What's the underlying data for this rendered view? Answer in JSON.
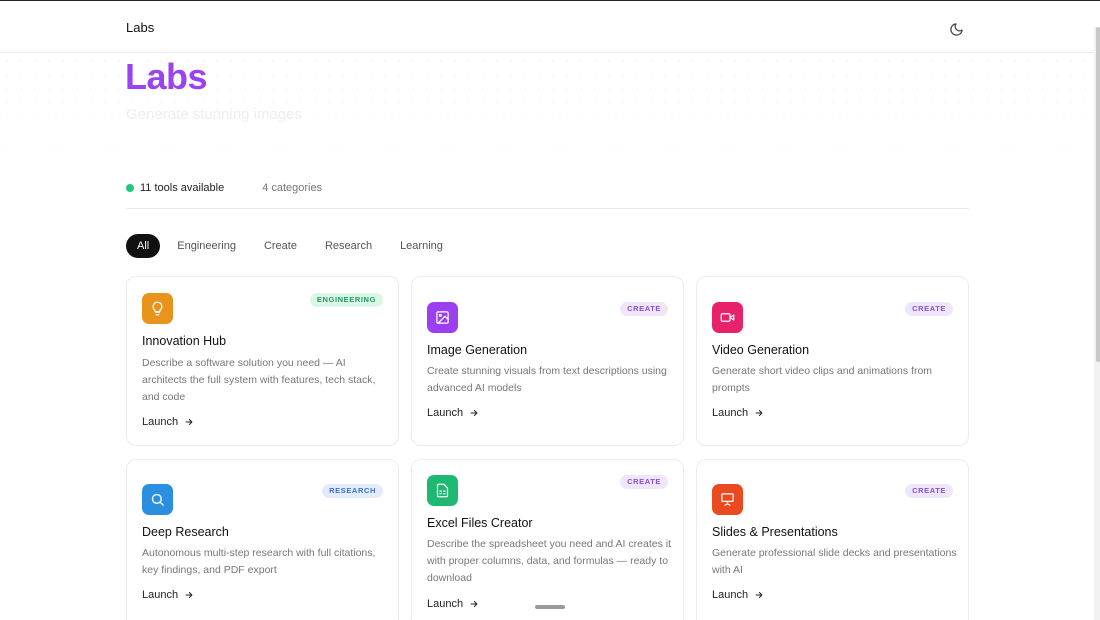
{
  "header": {
    "brand": "Labs",
    "theme_icon": "moon-icon"
  },
  "hero": {
    "title": "Labs",
    "subtitle": "Generate stunning images"
  },
  "stats": {
    "tools": "11 tools available",
    "categories": "4 categories",
    "status_color": "#21c97a"
  },
  "filters": [
    "All",
    "Engineering",
    "Create",
    "Research",
    "Learning"
  ],
  "active_filter": "All",
  "cards": [
    {
      "title": "Innovation Hub",
      "badge": "ENGINEERING",
      "icon": "lightbulb-icon",
      "icon_color": "#e8941c",
      "description": "Describe a software solution you need — AI architects the full system with features, tech stack, and code",
      "launch": "Launch"
    },
    {
      "title": "Image Generation",
      "badge": "CREATE",
      "icon": "image-icon",
      "icon_color": "#9b3ff0",
      "description": "Create stunning visuals from text descriptions using advanced AI models",
      "launch": "Launch"
    },
    {
      "title": "Video Generation",
      "badge": "CREATE",
      "icon": "video-icon",
      "icon_color": "#e8226a",
      "description": "Generate short video clips and animations from prompts",
      "launch": "Launch"
    },
    {
      "title": "Deep Research",
      "badge": "RESEARCH",
      "icon": "search-icon",
      "icon_color": "#2a8fe0",
      "description": "Autonomous multi-step research with full citations, key findings, and PDF export",
      "launch": "Launch"
    },
    {
      "title": "Excel Files Creator",
      "badge": "CREATE",
      "icon": "spreadsheet-icon",
      "icon_color": "#1fb873",
      "description": "Describe the spreadsheet you need and AI creates it with proper columns, data, and formulas — ready to download",
      "launch": "Launch"
    },
    {
      "title": "Slides & Presentations",
      "badge": "CREATE",
      "icon": "presentation-icon",
      "icon_color": "#ea4a1f",
      "description": "Generate professional slide decks and presentations with AI",
      "launch": "Launch"
    }
  ]
}
